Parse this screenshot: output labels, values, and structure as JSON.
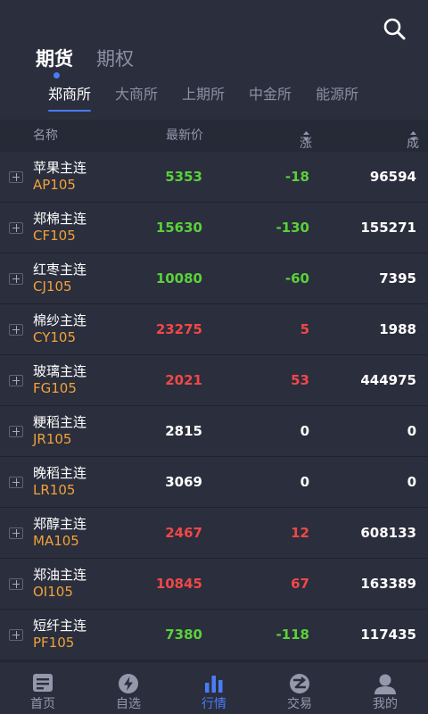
{
  "main_tabs": [
    {
      "label": "期货",
      "active": true
    },
    {
      "label": "期权",
      "active": false
    }
  ],
  "exchange_tabs": [
    {
      "label": "郑商所",
      "active": true
    },
    {
      "label": "大商所",
      "active": false
    },
    {
      "label": "上期所",
      "active": false
    },
    {
      "label": "中金所",
      "active": false
    },
    {
      "label": "能源所",
      "active": false
    }
  ],
  "table_header": {
    "name": "名称",
    "price": "最新价",
    "change": "涨跌",
    "volume": "成交量"
  },
  "rows": [
    {
      "name": "苹果主连",
      "code": "AP105",
      "price": "5353",
      "change": "-18",
      "volume": "96594",
      "trend": "down"
    },
    {
      "name": "郑棉主连",
      "code": "CF105",
      "price": "15630",
      "change": "-130",
      "volume": "155271",
      "trend": "down"
    },
    {
      "name": "红枣主连",
      "code": "CJ105",
      "price": "10080",
      "change": "-60",
      "volume": "7395",
      "trend": "down"
    },
    {
      "name": "棉纱主连",
      "code": "CY105",
      "price": "23275",
      "change": "5",
      "volume": "1988",
      "trend": "up"
    },
    {
      "name": "玻璃主连",
      "code": "FG105",
      "price": "2021",
      "change": "53",
      "volume": "444975",
      "trend": "up"
    },
    {
      "name": "粳稻主连",
      "code": "JR105",
      "price": "2815",
      "change": "0",
      "volume": "0",
      "trend": "flat"
    },
    {
      "name": "晚稻主连",
      "code": "LR105",
      "price": "3069",
      "change": "0",
      "volume": "0",
      "trend": "flat"
    },
    {
      "name": "郑醇主连",
      "code": "MA105",
      "price": "2467",
      "change": "12",
      "volume": "608133",
      "trend": "up"
    },
    {
      "name": "郑油主连",
      "code": "OI105",
      "price": "10845",
      "change": "67",
      "volume": "163389",
      "trend": "up"
    },
    {
      "name": "短纤主连",
      "code": "PF105",
      "price": "7380",
      "change": "-118",
      "volume": "117435",
      "trend": "down"
    }
  ],
  "bottom_nav": [
    {
      "label": "首页",
      "icon": "home-doc-icon",
      "active": false
    },
    {
      "label": "自选",
      "icon": "lightning-icon",
      "active": false
    },
    {
      "label": "行情",
      "icon": "bar-chart-icon",
      "active": true
    },
    {
      "label": "交易",
      "icon": "trade-icon",
      "active": false
    },
    {
      "label": "我的",
      "icon": "user-icon",
      "active": false
    }
  ],
  "colors": {
    "background": "#2b2e3c",
    "accent": "#4a7cf7",
    "up": "#f04848",
    "down": "#5ad13c",
    "code": "#f0a23b"
  }
}
